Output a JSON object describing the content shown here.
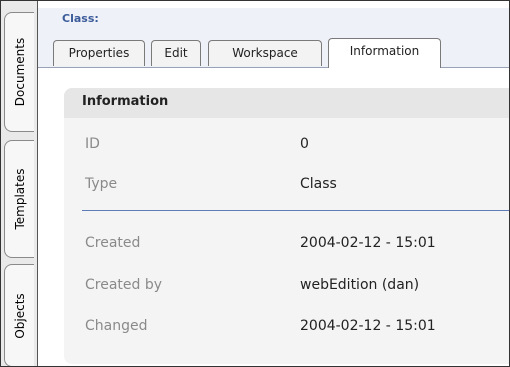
{
  "sidebar": {
    "tabs": [
      {
        "label": "Documents"
      },
      {
        "label": "Templates"
      },
      {
        "label": "Objects"
      }
    ]
  },
  "header": {
    "title": "Class:"
  },
  "tabs": [
    {
      "label": "Properties",
      "active": false
    },
    {
      "label": "Edit",
      "active": false
    },
    {
      "label": "Workspace",
      "active": false
    },
    {
      "label": "Information",
      "active": true
    }
  ],
  "info": {
    "title": "Information",
    "rows": [
      {
        "label": "ID",
        "value": "0"
      },
      {
        "label": "Type",
        "value": "Class"
      },
      {
        "label": "Created",
        "value": "2004-02-12 - 15:01"
      },
      {
        "label": "Created by",
        "value": "webEdition (dan)"
      },
      {
        "label": "Changed",
        "value": "2004-02-12 - 15:01"
      }
    ]
  },
  "colors": {
    "title_blue": "#3b5b9a",
    "separator_blue": "#5d7bb5"
  }
}
